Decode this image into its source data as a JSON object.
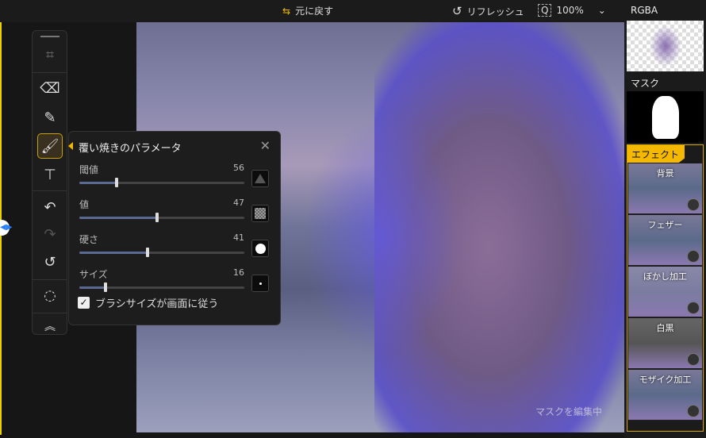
{
  "topbar": {
    "undo_label": "元に戻す",
    "refresh_label": "リフレッシュ",
    "zoom": "100%"
  },
  "canvas": {
    "status": "マスクを編集中"
  },
  "toolbar": {
    "tools": [
      "move",
      "eraser",
      "pen",
      "overburn-brush",
      "roller",
      "undo",
      "redo",
      "reset",
      "selection",
      "collapse"
    ],
    "active": "overburn-brush"
  },
  "panel": {
    "title": "覆い焼きのパラメータ",
    "params": [
      {
        "label": "閾値",
        "value": 56
      },
      {
        "label": "値",
        "value": 47
      },
      {
        "label": "硬さ",
        "value": 41
      },
      {
        "label": "サイズ",
        "value": 16
      }
    ],
    "checkbox": {
      "label": "ブラシサイズが画面に従う",
      "checked": true
    }
  },
  "right": {
    "rgba_label": "RGBA",
    "mask_label": "マスク",
    "effects_label": "エフェクト",
    "effects": [
      {
        "label": "背景"
      },
      {
        "label": "フェザー"
      },
      {
        "label": "ぼかし加工"
      },
      {
        "label": "白黒"
      },
      {
        "label": "モザイク加工"
      }
    ]
  },
  "colors": {
    "accent": "#f5b800",
    "mask": "#5a50e0"
  }
}
